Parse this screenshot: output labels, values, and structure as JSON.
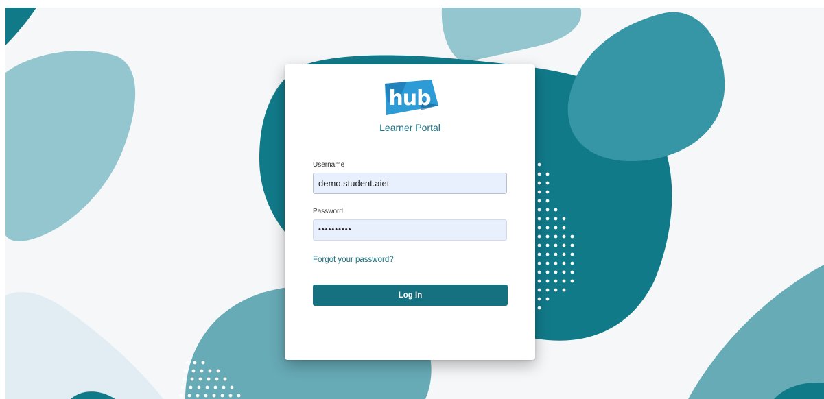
{
  "brand": {
    "logo_text": "hub",
    "portal_title": "Learner Portal"
  },
  "form": {
    "username_label": "Username",
    "username_value": "demo.student.aiet",
    "password_label": "Password",
    "password_value": "••••••••••",
    "forgot_link": "Forgot your password?",
    "login_button": "Log In"
  },
  "colors": {
    "accent": "#15707f",
    "logo_blue": "#2d9bd6",
    "blob_dark": "#117a89",
    "blob_mid": "#3796a5",
    "blob_light": "#94c6cf",
    "blob_pale": "#e2edf3",
    "background": "#f6f7f9"
  }
}
